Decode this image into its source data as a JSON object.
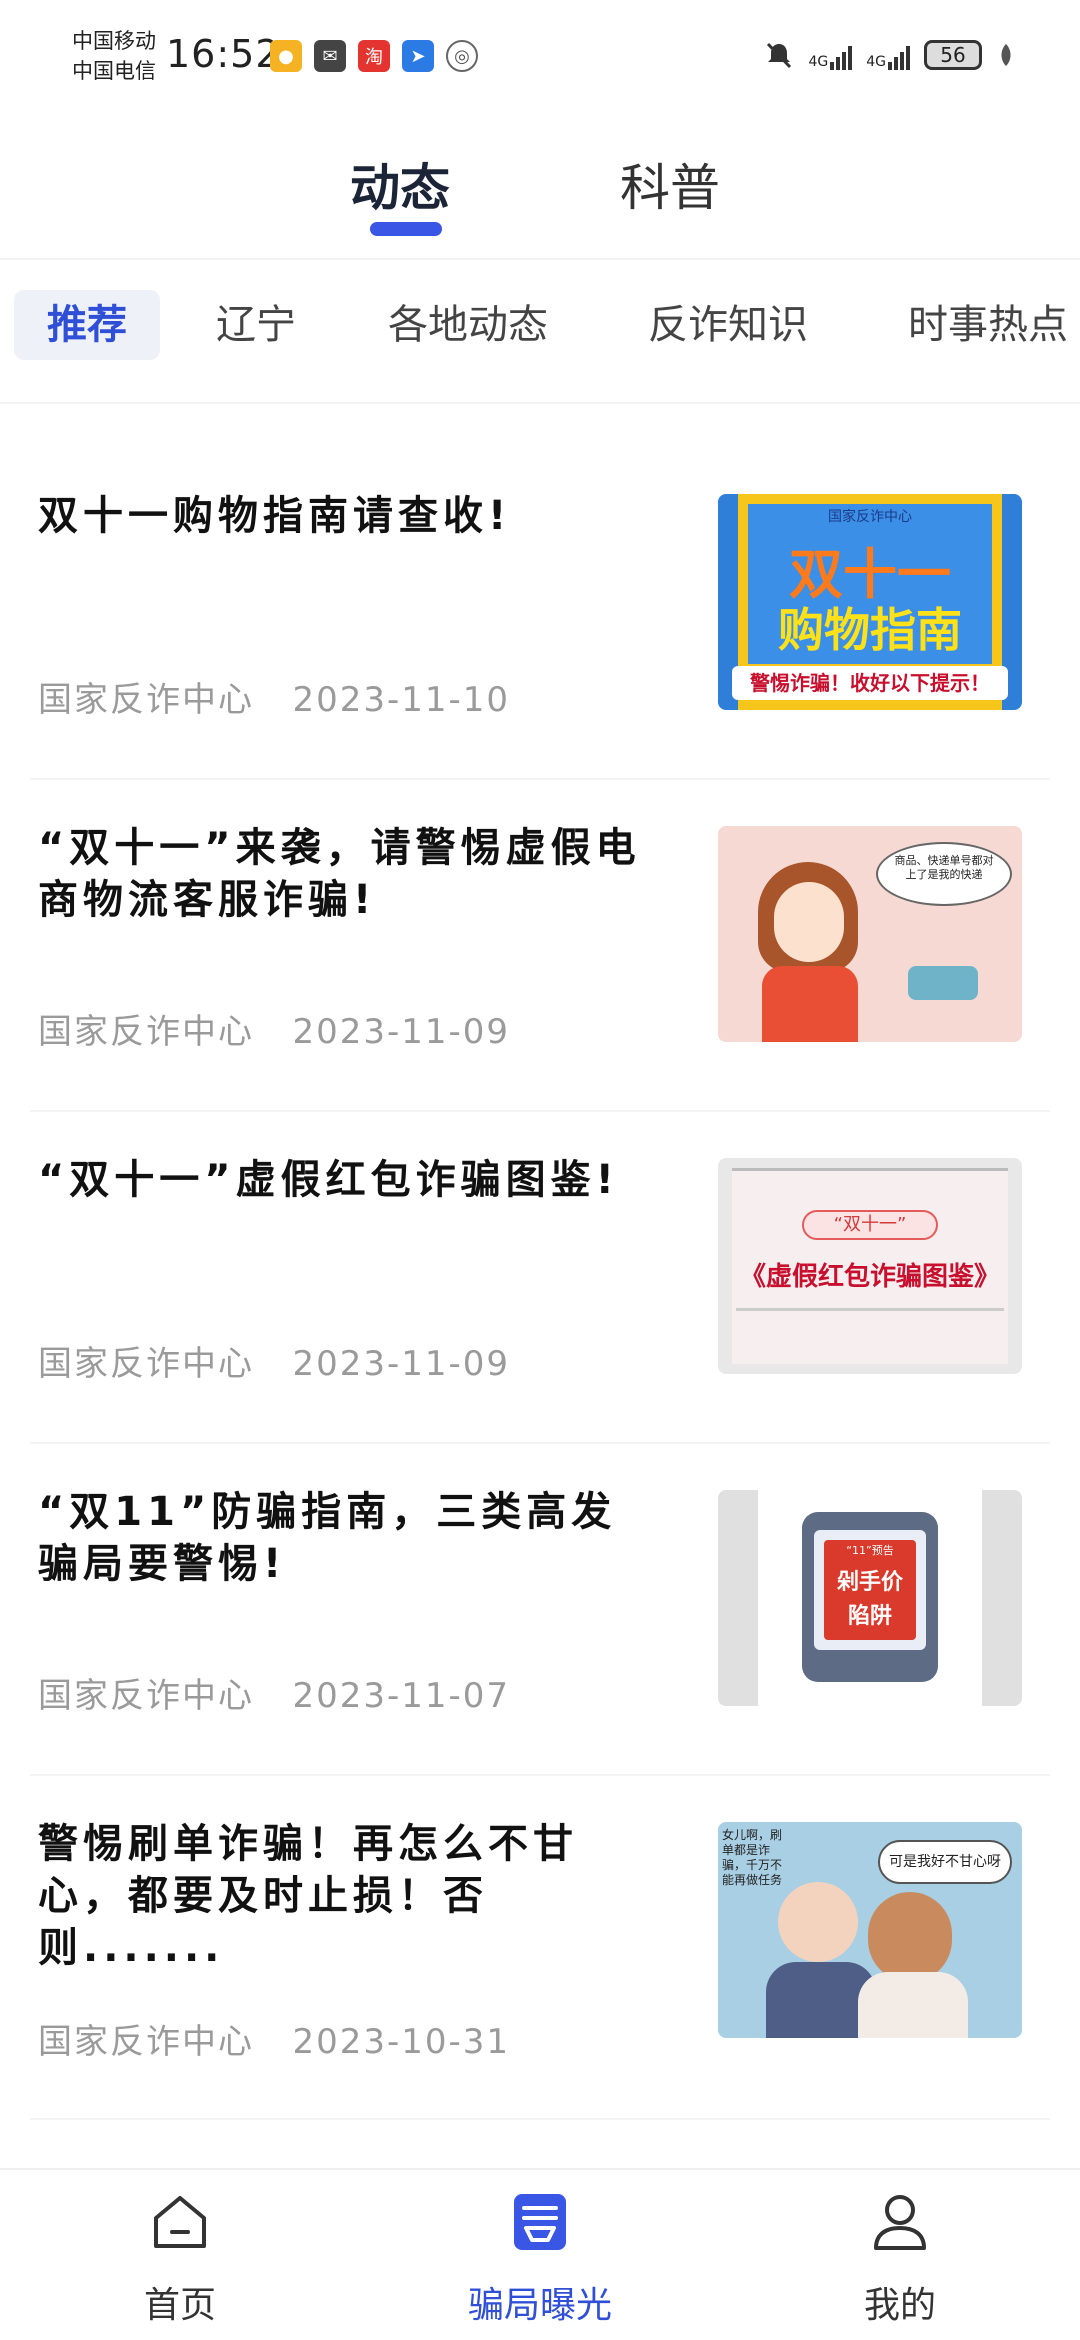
{
  "status_bar": {
    "carrier_1": "中国移动",
    "carrier_2": "中国电信",
    "time": "16:52",
    "network_1": "4G",
    "network_2": "4G",
    "battery": "56",
    "notification_icons": [
      "app-icon",
      "mail-icon",
      "taobao-icon",
      "send-icon",
      "location-icon"
    ]
  },
  "top_tabs": {
    "active": "动态",
    "other": "科普"
  },
  "categories": [
    "推荐",
    "辽宁",
    "各地动态",
    "反诈知识",
    "时事热点"
  ],
  "articles": [
    {
      "title": "双十一购物指南请查收!",
      "source": "国家反诈中心",
      "date": "2023-11-10",
      "thumb": {
        "badge": "国家反诈中心",
        "line1": "双十一",
        "line2": "购物指南",
        "caption": "警惕诈骗！收好以下提示！"
      }
    },
    {
      "title": "“双十一”来袭，请警惕虚假电商物流客服诈骗!",
      "source": "国家反诈中心",
      "date": "2023-11-09",
      "thumb": {
        "bubble": "商品、快递单号都对上了是我的快递"
      }
    },
    {
      "title": "“双十一”虚假红包诈骗图鉴!",
      "source": "国家反诈中心",
      "date": "2023-11-09",
      "thumb": {
        "tag": "“双十一”",
        "caption": "《虚假红包诈骗图鉴》"
      }
    },
    {
      "title": "“双11”防骗指南，三类高发骗局要警惕!",
      "source": "国家反诈中心",
      "date": "2023-11-07",
      "thumb": {
        "small": "“11”预告",
        "line1": "剁手价",
        "line2": "陷阱"
      }
    },
    {
      "title": "警惕刷单诈骗！再怎么不甘心，都要及时止损！否则.......",
      "source": "国家反诈中心",
      "date": "2023-10-31",
      "thumb": {
        "left_text": "女儿啊，刷单都是诈骗，千万不能再做任务",
        "bubble": "可是我好不甘心呀"
      }
    }
  ],
  "bottom_nav": [
    {
      "label": "首页",
      "icon": "home-icon",
      "active": false
    },
    {
      "label": "骗局曝光",
      "icon": "exposure-icon",
      "active": true
    },
    {
      "label": "我的",
      "icon": "user-icon",
      "active": false
    }
  ],
  "colors": {
    "accent": "#3a56e4",
    "active_category": "#2f4fd6",
    "meta_gray": "#9a9a9a"
  }
}
